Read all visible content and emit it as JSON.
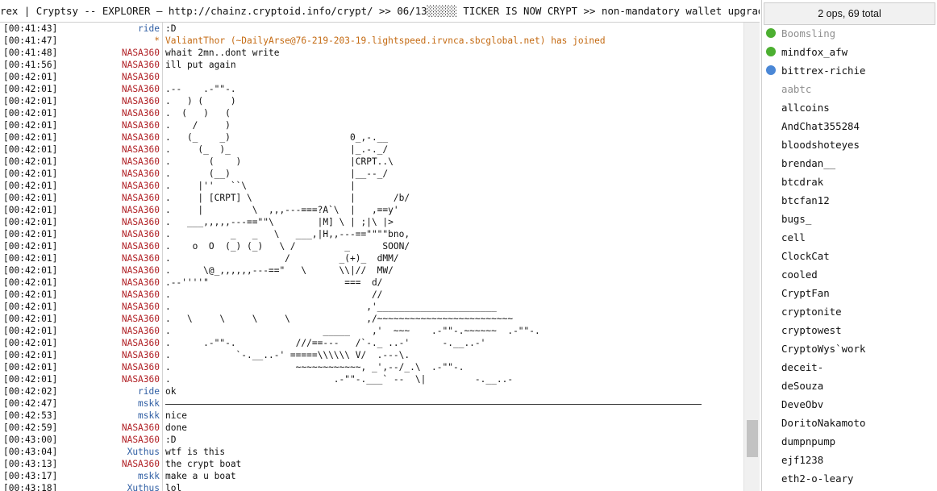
{
  "topic": "rex | Cryptsy -- EXPLORER — http://chainz.cryptoid.info/crypt/ >> 06/13░░░░░ TICKER IS NOW CRYPT >> non-mandatory wallet upgrade -",
  "user_panel": {
    "count_label": "2 ops, 69 total",
    "users": [
      {
        "name": "Boomsling",
        "status": "op",
        "status_color": "#4caf31",
        "away": true
      },
      {
        "name": "mindfox_afw",
        "status": "op",
        "status_color": "#4caf31",
        "away": false
      },
      {
        "name": "bittrex-richie",
        "status": "voice",
        "status_color": "#4a87d6",
        "away": false
      },
      {
        "name": "aabtc",
        "status": "",
        "status_color": "",
        "away": true
      },
      {
        "name": "allcoins",
        "status": "",
        "status_color": "",
        "away": false
      },
      {
        "name": "AndChat355284",
        "status": "",
        "status_color": "",
        "away": false
      },
      {
        "name": "bloodshoteyes",
        "status": "",
        "status_color": "",
        "away": false
      },
      {
        "name": "brendan__",
        "status": "",
        "status_color": "",
        "away": false
      },
      {
        "name": "btcdrak",
        "status": "",
        "status_color": "",
        "away": false
      },
      {
        "name": "btcfan12",
        "status": "",
        "status_color": "",
        "away": false
      },
      {
        "name": "bugs_",
        "status": "",
        "status_color": "",
        "away": false
      },
      {
        "name": "cell",
        "status": "",
        "status_color": "",
        "away": false
      },
      {
        "name": "ClockCat",
        "status": "",
        "status_color": "",
        "away": false
      },
      {
        "name": "cooled",
        "status": "",
        "status_color": "",
        "away": false
      },
      {
        "name": "CryptFan",
        "status": "",
        "status_color": "",
        "away": false
      },
      {
        "name": "cryptonite",
        "status": "",
        "status_color": "",
        "away": false
      },
      {
        "name": "cryptowest",
        "status": "",
        "status_color": "",
        "away": false
      },
      {
        "name": "CryptoWys`work",
        "status": "",
        "status_color": "",
        "away": false
      },
      {
        "name": "deceit-",
        "status": "",
        "status_color": "",
        "away": false
      },
      {
        "name": "deSouza",
        "status": "",
        "status_color": "",
        "away": false
      },
      {
        "name": "DeveObv",
        "status": "",
        "status_color": "",
        "away": false
      },
      {
        "name": "DoritoNakamoto",
        "status": "",
        "status_color": "",
        "away": false
      },
      {
        "name": "dumpnpump",
        "status": "",
        "status_color": "",
        "away": false
      },
      {
        "name": "ejf1238",
        "status": "",
        "status_color": "",
        "away": false
      },
      {
        "name": "eth2-o-leary",
        "status": "",
        "status_color": "",
        "away": false
      }
    ]
  },
  "chat": {
    "lines": [
      {
        "time": "[00:41:43]",
        "nick": "ride",
        "nick_color": "#2f5ea3",
        "text": ":D",
        "kind": "msg"
      },
      {
        "time": "[00:41:47]",
        "nick": "*",
        "nick_color": "#c46a12",
        "text": "ValiantThor (~DailyArse@76-219-203-19.lightspeed.irvnca.sbcglobal.net) has joined",
        "kind": "sys"
      },
      {
        "time": "[00:41:48]",
        "nick": "NASA360",
        "nick_color": "#b02025",
        "text": "whait 2mn..dont write",
        "kind": "msg"
      },
      {
        "time": "[00:41:56]",
        "nick": "NASA360",
        "nick_color": "#b02025",
        "text": "ill put again",
        "kind": "msg"
      },
      {
        "time": "[00:42:01]",
        "nick": "NASA360",
        "nick_color": "#b02025",
        "text": "",
        "kind": "msg"
      },
      {
        "time": "[00:42:01]",
        "nick": "NASA360",
        "nick_color": "#b02025",
        "text": ".--    .-\"\"-.",
        "kind": "msg"
      },
      {
        "time": "[00:42:01]",
        "nick": "NASA360",
        "nick_color": "#b02025",
        "text": ".   ) (     )",
        "kind": "msg"
      },
      {
        "time": "[00:42:01]",
        "nick": "NASA360",
        "nick_color": "#b02025",
        "text": ".  (   )   (",
        "kind": "msg"
      },
      {
        "time": "[00:42:01]",
        "nick": "NASA360",
        "nick_color": "#b02025",
        "text": ".    /     )",
        "kind": "msg"
      },
      {
        "time": "[00:42:01]",
        "nick": "NASA360",
        "nick_color": "#b02025",
        "text": ".   (_    _)                      0_,-.__",
        "kind": "msg"
      },
      {
        "time": "[00:42:01]",
        "nick": "NASA360",
        "nick_color": "#b02025",
        "text": ".     (_  )_                      |_.-._/",
        "kind": "msg"
      },
      {
        "time": "[00:42:01]",
        "nick": "NASA360",
        "nick_color": "#b02025",
        "text": ".       (    )                    |CRPT..\\",
        "kind": "msg"
      },
      {
        "time": "[00:42:01]",
        "nick": "NASA360",
        "nick_color": "#b02025",
        "text": ".       (__)                      |__--_/",
        "kind": "msg"
      },
      {
        "time": "[00:42:01]",
        "nick": "NASA360",
        "nick_color": "#b02025",
        "text": ".     |''   ``\\                   |",
        "kind": "msg"
      },
      {
        "time": "[00:42:01]",
        "nick": "NASA360",
        "nick_color": "#b02025",
        "text": ".     | [CRPT] \\                  |       /b/",
        "kind": "msg"
      },
      {
        "time": "[00:42:01]",
        "nick": "NASA360",
        "nick_color": "#b02025",
        "text": ".     |         \\  ,,,---===?A`\\  |   ,==y'",
        "kind": "msg"
      },
      {
        "time": "[00:42:01]",
        "nick": "NASA360",
        "nick_color": "#b02025",
        "text": ".   ___,,,,,---==\"\"\\        |M] \\ | ;|\\ |>",
        "kind": "msg"
      },
      {
        "time": "[00:42:01]",
        "nick": "NASA360",
        "nick_color": "#b02025",
        "text": ".           _   _   \\   ___,|H,,---==\"\"\"\"bno,",
        "kind": "msg"
      },
      {
        "time": "[00:42:01]",
        "nick": "NASA360",
        "nick_color": "#b02025",
        "text": ".    o  O  (_) (_)   \\ /         _      SOON/",
        "kind": "msg"
      },
      {
        "time": "[00:42:01]",
        "nick": "NASA360",
        "nick_color": "#b02025",
        "text": ".                     /         _(+)_  dMM/",
        "kind": "msg"
      },
      {
        "time": "[00:42:01]",
        "nick": "NASA360",
        "nick_color": "#b02025",
        "text": ".      \\@_,,,,,,---==\"   \\      \\\\|//  MW/",
        "kind": "msg"
      },
      {
        "time": "[00:42:01]",
        "nick": "NASA360",
        "nick_color": "#b02025",
        "text": ".--''''\"                         ===  d/",
        "kind": "msg"
      },
      {
        "time": "[00:42:01]",
        "nick": "NASA360",
        "nick_color": "#b02025",
        "text": ".                                     //",
        "kind": "msg"
      },
      {
        "time": "[00:42:01]",
        "nick": "NASA360",
        "nick_color": "#b02025",
        "text": ".                                    ,'______________________",
        "kind": "msg"
      },
      {
        "time": "[00:42:01]",
        "nick": "NASA360",
        "nick_color": "#b02025",
        "text": ".   \\     \\     \\     \\              ,/~~~~~~~~~~~~~~~~~~~~~~~~~",
        "kind": "msg"
      },
      {
        "time": "[00:42:01]",
        "nick": "NASA360",
        "nick_color": "#b02025",
        "text": ".                            _____    ,'  ~~~    .-\"\"-.~~~~~~  .-\"\"-.",
        "kind": "msg"
      },
      {
        "time": "[00:42:01]",
        "nick": "NASA360",
        "nick_color": "#b02025",
        "text": ".      .-\"\"-.           ///==---   /`-._ ..-'      -.__..-'",
        "kind": "msg"
      },
      {
        "time": "[00:42:01]",
        "nick": "NASA360",
        "nick_color": "#b02025",
        "text": ".            `-.__..-' =====\\\\\\\\\\\\ V/  .---\\.",
        "kind": "msg"
      },
      {
        "time": "[00:42:01]",
        "nick": "NASA360",
        "nick_color": "#b02025",
        "text": ".                       ~~~~~~~~~~~~, _',--/_.\\  .-\"\"-.",
        "kind": "msg"
      },
      {
        "time": "[00:42:01]",
        "nick": "NASA360",
        "nick_color": "#b02025",
        "text": ".                              .-\"\"-.___` --  \\|         -.__..-",
        "kind": "msg"
      },
      {
        "time": "[00:42:02]",
        "nick": "ride",
        "nick_color": "#2f5ea3",
        "text": "ok",
        "kind": "msg"
      },
      {
        "time": "[00:42:47]",
        "nick": "mskk",
        "nick_color": "#2f5ea3",
        "text": "",
        "kind": "rule"
      },
      {
        "time": "[00:42:53]",
        "nick": "mskk",
        "nick_color": "#2f5ea3",
        "text": "nice",
        "kind": "msg"
      },
      {
        "time": "[00:42:59]",
        "nick": "NASA360",
        "nick_color": "#b02025",
        "text": "done",
        "kind": "msg"
      },
      {
        "time": "[00:43:00]",
        "nick": "NASA360",
        "nick_color": "#b02025",
        "text": ":D",
        "kind": "msg"
      },
      {
        "time": "[00:43:04]",
        "nick": "Xuthus",
        "nick_color": "#2f5ea3",
        "text": "wtf is this",
        "kind": "msg"
      },
      {
        "time": "[00:43:13]",
        "nick": "NASA360",
        "nick_color": "#b02025",
        "text": "the crypt boat",
        "kind": "msg"
      },
      {
        "time": "[00:43:17]",
        "nick": "mskk",
        "nick_color": "#2f5ea3",
        "text": "make a u boat",
        "kind": "msg"
      },
      {
        "time": "[00:43:18]",
        "nick": "Xuthus",
        "nick_color": "#2f5ea3",
        "text": "lol",
        "kind": "msg"
      }
    ]
  }
}
